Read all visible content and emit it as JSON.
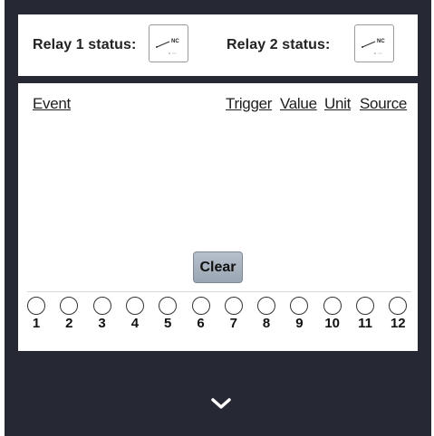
{
  "relays": [
    {
      "label": "Relay 1 status:",
      "state": "NC"
    },
    {
      "label": "Relay 2 status:",
      "state": "NC"
    }
  ],
  "event_log": {
    "columns": [
      "Event",
      "Trigger",
      "Value",
      "Unit",
      "Source"
    ],
    "rows": [],
    "clear_label": "Clear"
  },
  "indicators": [
    "1",
    "2",
    "3",
    "4",
    "5",
    "6",
    "7",
    "8",
    "9",
    "10",
    "11",
    "12"
  ],
  "colors": {
    "frame": "#262833",
    "panel": "#ffffff",
    "button": "#a7b1bd"
  },
  "footer": {
    "icon": "chevron-down-icon"
  }
}
